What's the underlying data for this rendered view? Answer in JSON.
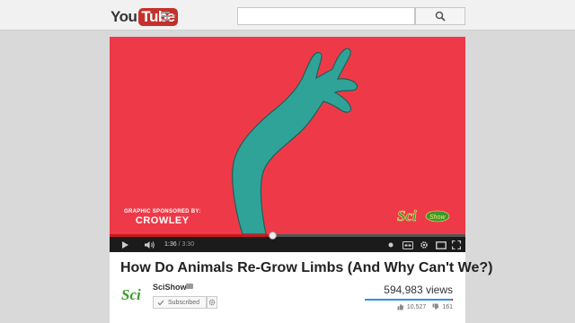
{
  "header": {
    "logo_you": "You",
    "logo_tube": "Tube",
    "search_placeholder": ""
  },
  "video": {
    "sponsor_line": "GRAPHIC SPONSORED BY:",
    "sponsor_name": "CROWLEY",
    "watermark": "Sci Show"
  },
  "player": {
    "time_current": "1:36",
    "time_total": " / 3:30",
    "progress_fraction": 0.457
  },
  "info": {
    "title": "How Do Animals Re-Grow Limbs (And Why Can't We?)",
    "channel": "SciShow",
    "subscribe_label": "Subscribed",
    "views": "594,983 views",
    "likes": "10,527",
    "dislikes": "161",
    "like_ratio": 0.985
  },
  "colors": {
    "video_bg": "#ee3a48",
    "hand": "#2fa397",
    "accent": "#cc181e",
    "like_blue": "#2793e6",
    "brand_green": "#3a9a2a"
  }
}
